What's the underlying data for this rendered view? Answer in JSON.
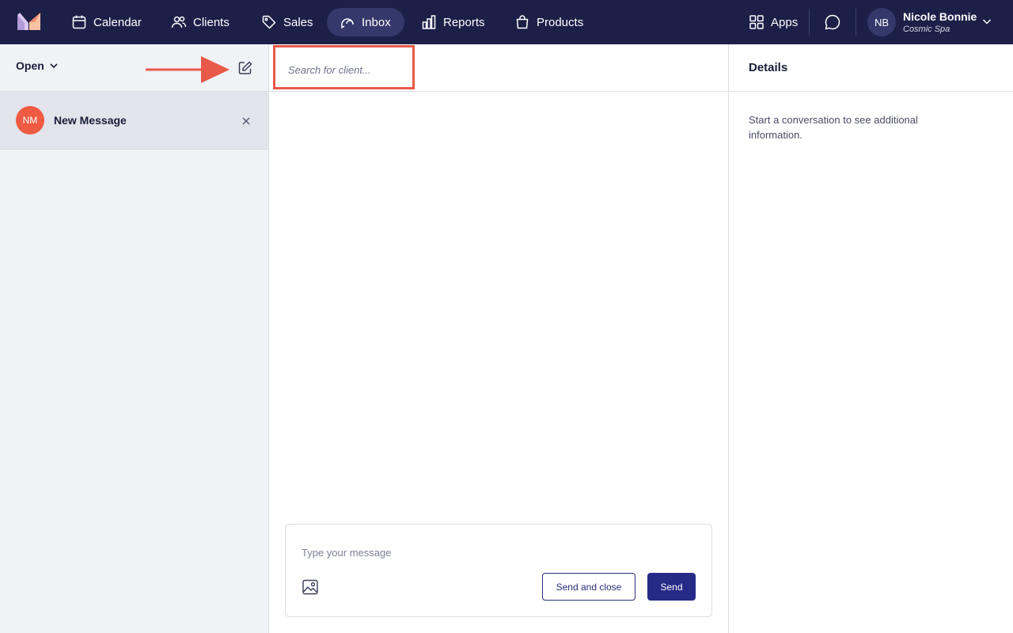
{
  "nav": {
    "items": [
      {
        "label": "Calendar",
        "icon": "calendar-icon"
      },
      {
        "label": "Clients",
        "icon": "users-icon"
      },
      {
        "label": "Sales",
        "icon": "tag-icon"
      },
      {
        "label": "Inbox",
        "icon": "inbox-chat-icon",
        "active": true
      },
      {
        "label": "Reports",
        "icon": "bar-chart-icon"
      },
      {
        "label": "Products",
        "icon": "shopping-bag-icon"
      }
    ],
    "apps_label": "Apps",
    "user": {
      "initials": "NB",
      "name": "Nicole Bonnie",
      "business": "Cosmic Spa"
    }
  },
  "inbox": {
    "filter_label": "Open",
    "conversations": [
      {
        "initials": "NM",
        "title": "New Message"
      }
    ]
  },
  "compose": {
    "search_placeholder": "Search for client...",
    "message_placeholder": "Type your message",
    "send_close_label": "Send and close",
    "send_label": "Send"
  },
  "details": {
    "title": "Details",
    "empty_text": "Start a conversation to see additional information."
  },
  "colors": {
    "nav_bg": "#1c1f47",
    "nav_active": "#34386a",
    "accent": "#262a86",
    "avatar_orange": "#ef5a43",
    "highlight_red": "#e8594a"
  }
}
